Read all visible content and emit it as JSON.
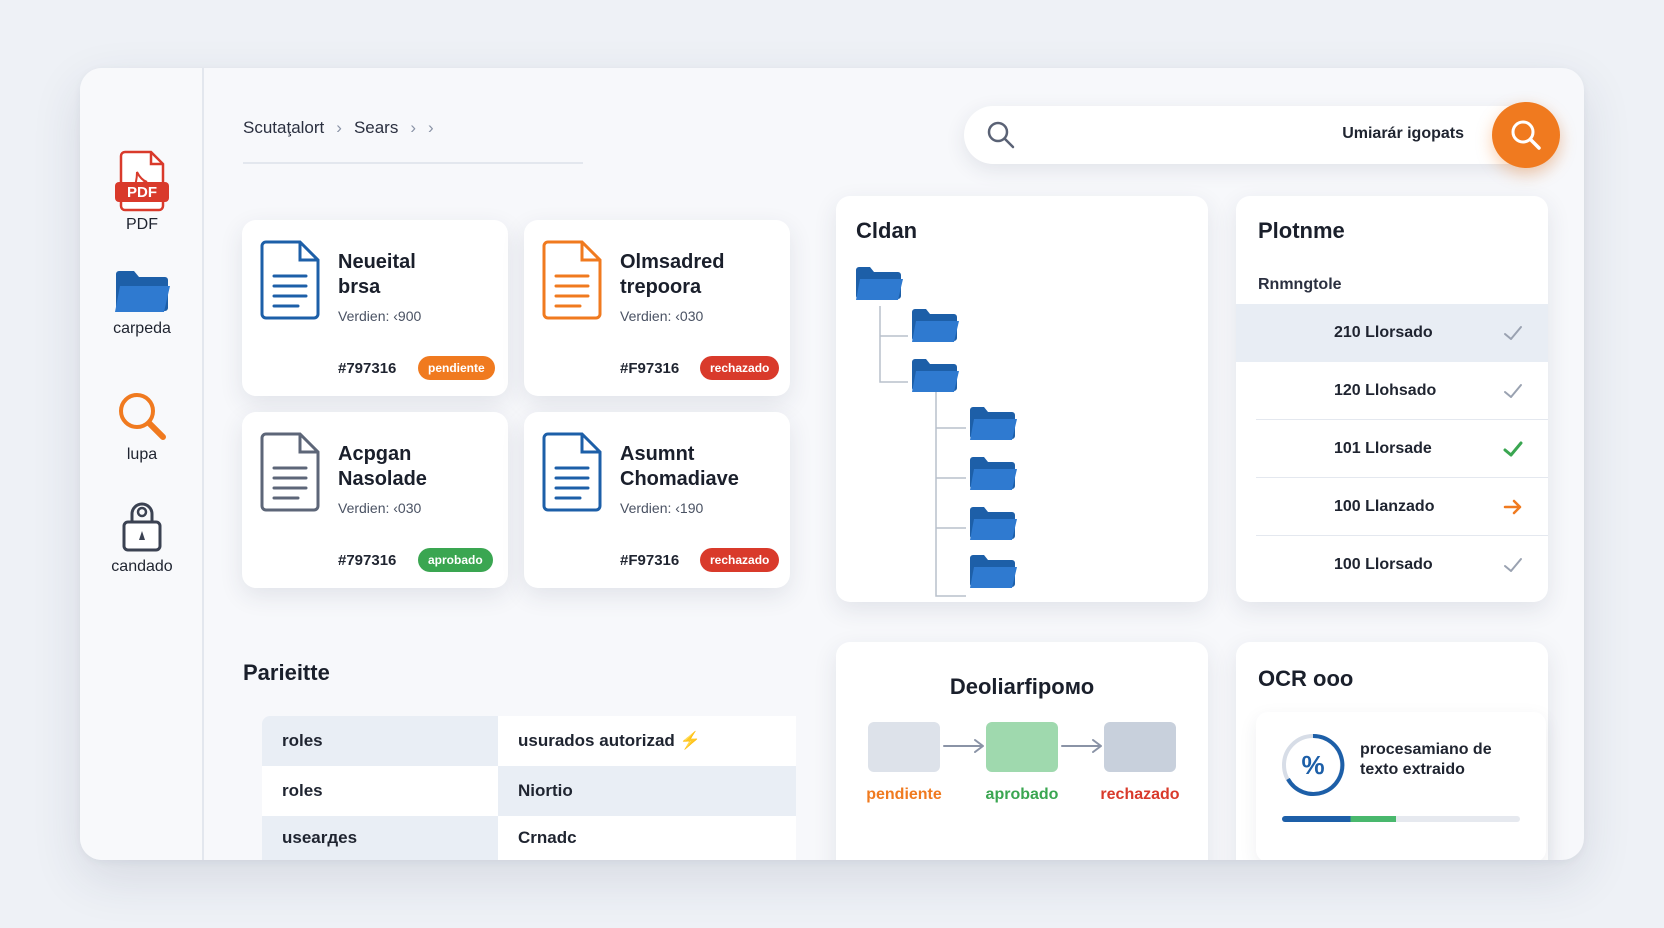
{
  "sidebar": {
    "items": [
      {
        "label": "PDF",
        "icon": "pdf-icon"
      },
      {
        "label": "carpeda",
        "icon": "folder-icon"
      },
      {
        "label": "lupa",
        "icon": "magnifier-icon"
      },
      {
        "label": "candado",
        "icon": "lock-icon"
      }
    ]
  },
  "breadcrumb": {
    "items": [
      "Scutaţalort",
      "Sears"
    ]
  },
  "search": {
    "text": "Umiarár igopats",
    "icon": "search-icon"
  },
  "documents": [
    {
      "title": "Neueital\nbrsa",
      "version": "Verdien: ‹900",
      "id": "#797316",
      "status": "pendiente",
      "icon_color": "#1d5fa8"
    },
    {
      "title": "Olmsadred\ntrepoora",
      "version": "Verdien: ‹030",
      "id": "#F97316",
      "status": "rechazado",
      "icon_color": "#f07a1f"
    },
    {
      "title": "Acpgan\nNasolade",
      "version": "Verdien: ‹030",
      "id": "#797316",
      "status": "aprobado",
      "icon_color": "#5d6678"
    },
    {
      "title": "Asumnt\nChomadiave",
      "version": "Verdien: ‹190",
      "id": "#F97316",
      "status": "rechazado",
      "icon_color": "#1d5fa8"
    }
  ],
  "status_colors": {
    "pendiente": "#f07a1f",
    "rechazado": "#d93a2b",
    "aprobado": "#3aa651"
  },
  "folders": {
    "title": "Cldan"
  },
  "process_list": {
    "title": "Plotnme",
    "subtitle": "Rnmngtole",
    "rows": [
      {
        "label": "210 Llorsado",
        "mark": "check",
        "color": "#9aa2b1",
        "highlight": true
      },
      {
        "label": "120 Llohsado",
        "mark": "check",
        "color": "#9aa2b1",
        "highlight": false
      },
      {
        "label": "101 Llorsade",
        "mark": "check",
        "color": "#3aa651",
        "highlight": false
      },
      {
        "label": "100 Llanzado",
        "mark": "arrow",
        "color": "#f07a1f",
        "highlight": false
      },
      {
        "label": "100 Llorsado",
        "mark": "check",
        "color": "#9aa2b1",
        "highlight": false
      }
    ]
  },
  "permissions": {
    "title": "Parieitte",
    "rows": [
      {
        "col1": "roles",
        "col2": "usurados autorizad ⚡"
      },
      {
        "col1": "roles",
        "col2": "Niortio"
      },
      {
        "col1": "usearдes",
        "col2": "Crnadc"
      }
    ]
  },
  "workflow": {
    "title": "Deoliarfipoмо",
    "steps": [
      {
        "label": "pendiente",
        "box": "#dde2ea",
        "text_color": "#f07a1f"
      },
      {
        "label": "aprobado",
        "box": "#9fd9ae",
        "text_color": "#3aa651"
      },
      {
        "label": "rechazado",
        "box": "#c8d0dc",
        "text_color": "#d93a2b"
      }
    ]
  },
  "ocr": {
    "title": "OCR ooo",
    "description": "procesamiano de\ntexto extraido",
    "progress": 0.48,
    "icon": "percent-icon"
  }
}
